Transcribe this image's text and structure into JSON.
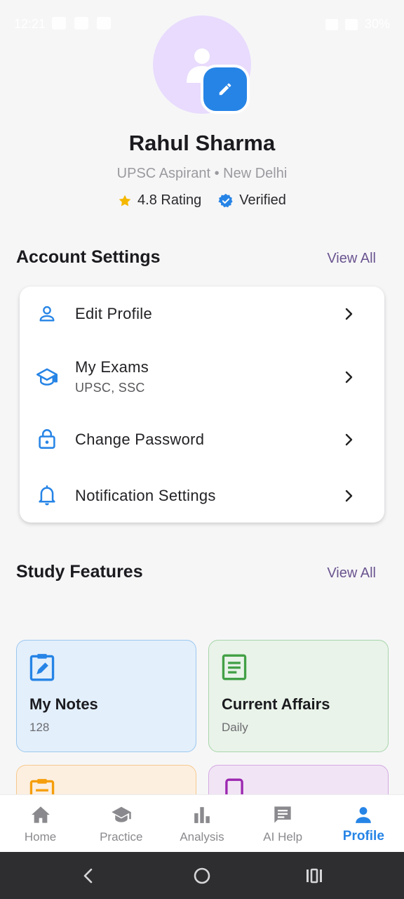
{
  "status_bar": {
    "time": "12:21",
    "battery": "30%"
  },
  "profile": {
    "name": "Rahul Sharma",
    "subtitle": "UPSC Aspirant • New Delhi",
    "rating": "4.8 Rating",
    "verified": "Verified",
    "avatar_color": "#e8dbfd",
    "edit_badge_color": "#2684e6"
  },
  "account_settings": {
    "title": "Account Settings",
    "view_all": "View All",
    "items": [
      {
        "label": "Edit Profile",
        "icon": "person-outline-icon"
      },
      {
        "label": "My Exams",
        "sublabel": "UPSC, SSC",
        "icon": "graduation-cap-icon"
      },
      {
        "label": "Change Password",
        "icon": "lock-icon"
      },
      {
        "label": "Notification Settings",
        "icon": "bell-icon"
      }
    ]
  },
  "study_features": {
    "title": "Study Features",
    "view_all": "View All",
    "cards": [
      {
        "title": "My Notes",
        "subtitle": "128",
        "icon": "edit-note-icon",
        "bg": "#e3effb",
        "border": "#9cc8ef",
        "icon_color": "#2684e6"
      },
      {
        "title": "Current Affairs",
        "subtitle": "Daily",
        "icon": "article-icon",
        "bg": "#e9f3e9",
        "border": "#a8d5aa",
        "icon_color": "#43a047"
      },
      {
        "title": "",
        "subtitle": "",
        "icon": "clipboard-icon",
        "bg": "#fcefe0",
        "border": "#f6c98e",
        "icon_color": "#f59e0b"
      },
      {
        "title": "",
        "subtitle": "",
        "icon": "phone-icon",
        "bg": "#f1e5f5",
        "border": "#d3a9e2",
        "icon_color": "#9c27b0"
      }
    ]
  },
  "bottom_nav": {
    "items": [
      {
        "label": "Home",
        "icon": "home-icon"
      },
      {
        "label": "Practice",
        "icon": "graduation-cap-icon"
      },
      {
        "label": "Analysis",
        "icon": "bar-chart-icon"
      },
      {
        "label": "AI Help",
        "icon": "chat-icon"
      },
      {
        "label": "Profile",
        "icon": "person-icon",
        "active": true
      }
    ],
    "active_color": "#2684e6"
  }
}
